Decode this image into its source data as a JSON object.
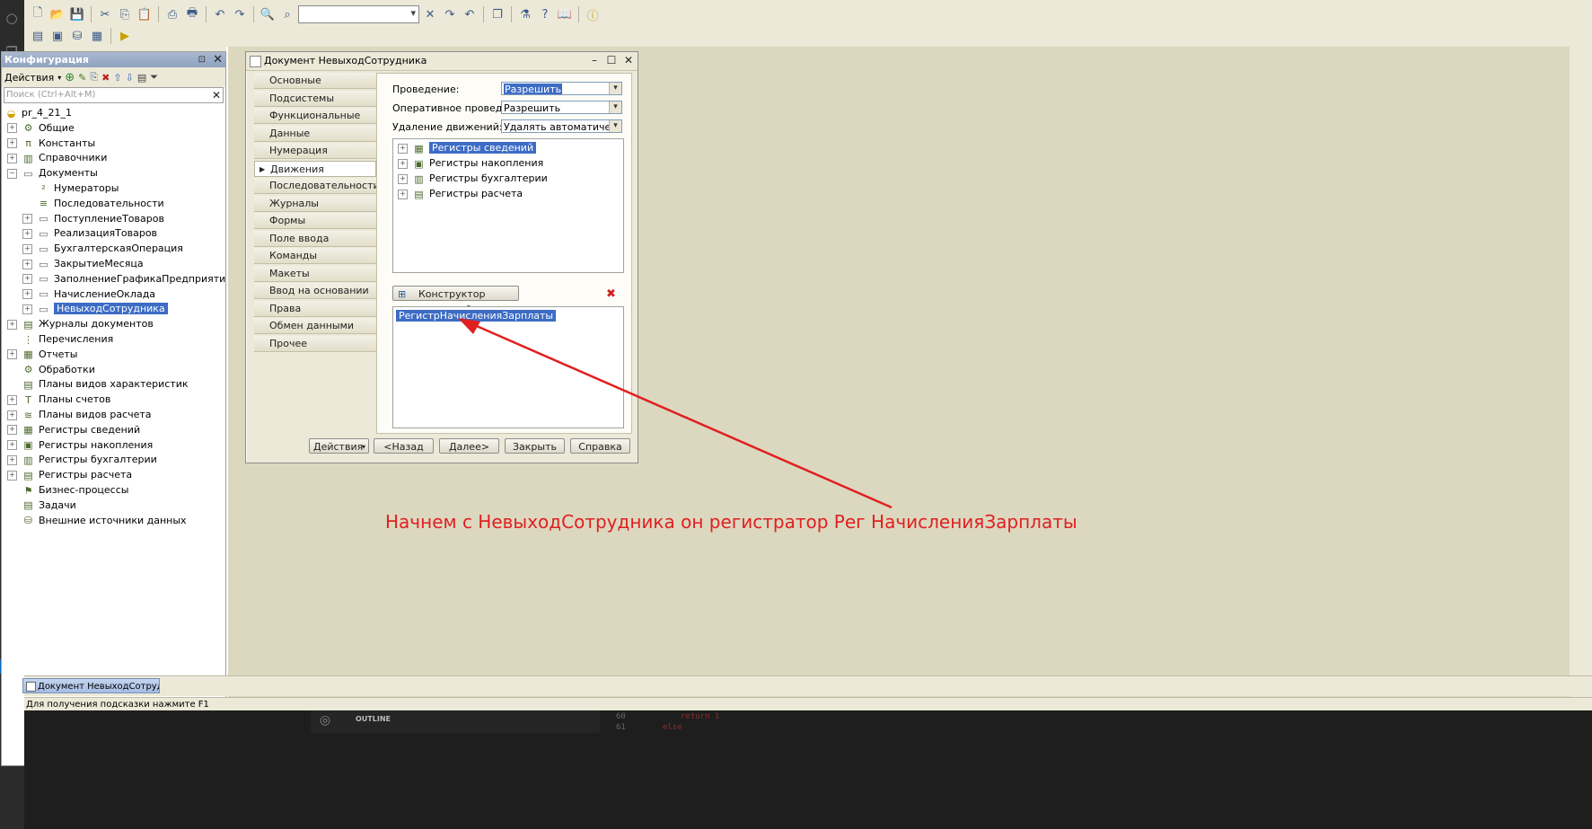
{
  "config_panel": {
    "title": "Конфигурация",
    "actions_label": "Действия",
    "search_placeholder": "Поиск (Ctrl+Alt+M)",
    "tree": [
      {
        "label": "pr_4_21_1",
        "level": 0,
        "expand": false,
        "icon": "config-icon"
      },
      {
        "label": "Общие",
        "level": 1,
        "expand": true,
        "icon": "common-icon"
      },
      {
        "label": "Константы",
        "level": 1,
        "expand": true,
        "icon": "constants-icon"
      },
      {
        "label": "Справочники",
        "level": 1,
        "expand": true,
        "icon": "catalogs-icon"
      },
      {
        "label": "Документы",
        "level": 1,
        "expand": true,
        "expanded": true,
        "icon": "documents-icon"
      },
      {
        "label": "Нумераторы",
        "level": 2,
        "expand": false,
        "icon": "numerators-icon"
      },
      {
        "label": "Последовательности",
        "level": 2,
        "expand": false,
        "icon": "sequences-icon"
      },
      {
        "label": "ПоступлениеТоваров",
        "level": 2,
        "expand": true,
        "icon": "document-icon"
      },
      {
        "label": "РеализацияТоваров",
        "level": 2,
        "expand": true,
        "icon": "document-icon"
      },
      {
        "label": "БухгалтерскаяОперация",
        "level": 2,
        "expand": true,
        "icon": "document-icon"
      },
      {
        "label": "ЗакрытиеМесяца",
        "level": 2,
        "expand": true,
        "icon": "document-icon"
      },
      {
        "label": "ЗаполнениеГрафикаПредприятия",
        "level": 2,
        "expand": true,
        "icon": "document-icon"
      },
      {
        "label": "НачислениеОклада",
        "level": 2,
        "expand": true,
        "icon": "document-icon"
      },
      {
        "label": "НевыходСотрудника",
        "level": 2,
        "expand": true,
        "icon": "document-icon",
        "selected": true
      },
      {
        "label": "Журналы документов",
        "level": 1,
        "expand": true,
        "icon": "journals-icon"
      },
      {
        "label": "Перечисления",
        "level": 1,
        "expand": false,
        "icon": "enums-icon"
      },
      {
        "label": "Отчеты",
        "level": 1,
        "expand": true,
        "icon": "reports-icon"
      },
      {
        "label": "Обработки",
        "level": 1,
        "expand": false,
        "icon": "processing-icon"
      },
      {
        "label": "Планы видов характеристик",
        "level": 1,
        "expand": false,
        "icon": "chart-chars-icon"
      },
      {
        "label": "Планы счетов",
        "level": 1,
        "expand": true,
        "icon": "chart-accounts-icon"
      },
      {
        "label": "Планы видов расчета",
        "level": 1,
        "expand": true,
        "icon": "chart-calc-icon"
      },
      {
        "label": "Регистры сведений",
        "level": 1,
        "expand": true,
        "icon": "info-registers-icon"
      },
      {
        "label": "Регистры накопления",
        "level": 1,
        "expand": true,
        "icon": "accum-registers-icon"
      },
      {
        "label": "Регистры бухгалтерии",
        "level": 1,
        "expand": true,
        "icon": "account-registers-icon"
      },
      {
        "label": "Регистры расчета",
        "level": 1,
        "expand": true,
        "icon": "calc-registers-icon"
      },
      {
        "label": "Бизнес-процессы",
        "level": 1,
        "expand": false,
        "icon": "business-process-icon"
      },
      {
        "label": "Задачи",
        "level": 1,
        "expand": false,
        "icon": "tasks-icon"
      },
      {
        "label": "Внешние источники данных",
        "level": 1,
        "expand": false,
        "icon": "external-sources-icon"
      }
    ]
  },
  "dialog": {
    "title": "Документ НевыходСотрудника",
    "nav": [
      "Основные",
      "Подсистемы",
      "Функциональные опции",
      "Данные",
      "Нумерация",
      "Движения",
      "Последовательности",
      "Журналы",
      "Формы",
      "Поле ввода",
      "Команды",
      "Макеты",
      "Ввод на основании",
      "Права",
      "Обмен данными",
      "Прочее"
    ],
    "active_nav": "Движения",
    "posting_label": "Проведение:",
    "posting_value": "Разрешить",
    "realtime_label": "Оперативное проведение:",
    "realtime_value": "Разрешить",
    "delete_label": "Удаление движений:",
    "delete_value": "Удалять автоматически п",
    "register_groups": [
      "Регистры сведений",
      "Регистры накопления",
      "Регистры бухгалтерии",
      "Регистры расчета"
    ],
    "constructor_label": "Конструктор движений",
    "selected_registers": [
      "РегистрНачисленияЗарплаты"
    ],
    "buttons": {
      "actions": "Действия",
      "back": "<Назад",
      "next": "Далее>",
      "close": "Закрыть",
      "help": "Справка"
    }
  },
  "annotation": "Начнем с НевыходСотрудника он регистратор Рег НачисленияЗарплаты",
  "taskbar": {
    "window": "Документ НевыходСотруд..."
  },
  "status": "Для получения подсказки нажмите F1",
  "vscode": {
    "outline": "OUTLINE",
    "code_lines": [
      {
        "num": "60",
        "text": "return 1"
      },
      {
        "num": "61",
        "text": "else"
      }
    ]
  },
  "colors": {
    "accent": "#3d6cc5",
    "annotation": "#e02020"
  }
}
